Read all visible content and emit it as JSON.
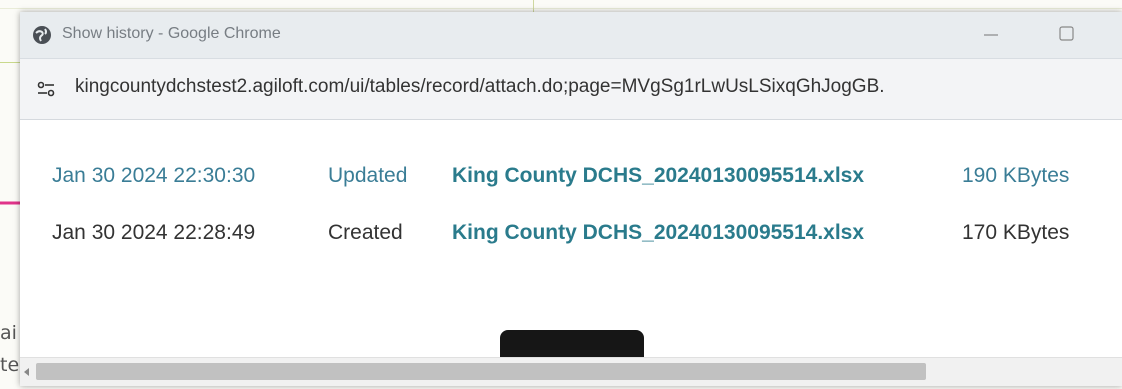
{
  "window": {
    "title": "Show history - Google Chrome",
    "url": "kingcountydchstest2.agiloft.com/ui/tables/record/attach.do;page=MVgSg1rLwUsLSixqGhJogGB."
  },
  "history": [
    {
      "date": "Jan 30 2024 22:30:30",
      "action": "Updated",
      "file": "King County DCHS_20240130095514.xlsx",
      "size": "190 KBytes"
    },
    {
      "date": "Jan 30 2024 22:28:49",
      "action": "Created",
      "file": "King County DCHS_20240130095514.xlsx",
      "size": "170 KBytes"
    }
  ],
  "background": {
    "text_fragment_1": "ai",
    "text_fragment_2": "te"
  },
  "colors": {
    "link": "#2a7b8c",
    "updated_row": "#3a7d96",
    "arrow": "#e0338a"
  },
  "icons": {
    "window": "globe-icon",
    "site_info": "tune-icon",
    "minimize": "minimize-icon",
    "maximize": "maximize-icon",
    "scroll_left": "chevron-left-icon"
  }
}
